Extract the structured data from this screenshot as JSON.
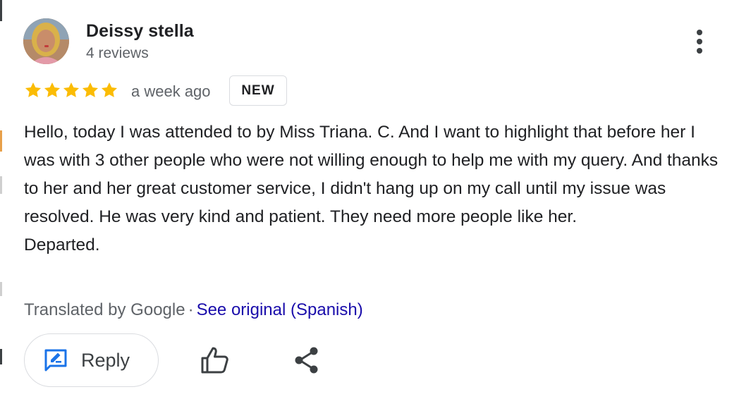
{
  "reviewer": {
    "name": "Deissy stella",
    "review_count": "4 reviews"
  },
  "rating": {
    "stars": 5,
    "max_stars": 5,
    "star_color": "#fbbc04",
    "time_ago": "a week ago",
    "badge": "NEW"
  },
  "review": {
    "lines": [
      "Hello, today I was attended to by Miss Triana. C. And I want to highlight that before her I was with 3 other people who were not willing enough to help me with my query. And thanks to her and her great customer service, I didn't hang up on my call until my issue was resolved. He was very kind and patient. They need more people like her.",
      "Departed."
    ]
  },
  "translation": {
    "label": "Translated by Google",
    "separator": "·",
    "link": "See original (Spanish)"
  },
  "actions": {
    "reply_label": "Reply",
    "reply_icon": "rate-review-icon",
    "like_icon": "thumb-up-icon",
    "share_icon": "share-icon",
    "more_icon": "more-vert-icon"
  },
  "colors": {
    "accent": "#1a73e8",
    "link": "#1a0dab",
    "text": "#202124",
    "secondary_text": "#5f6368"
  }
}
